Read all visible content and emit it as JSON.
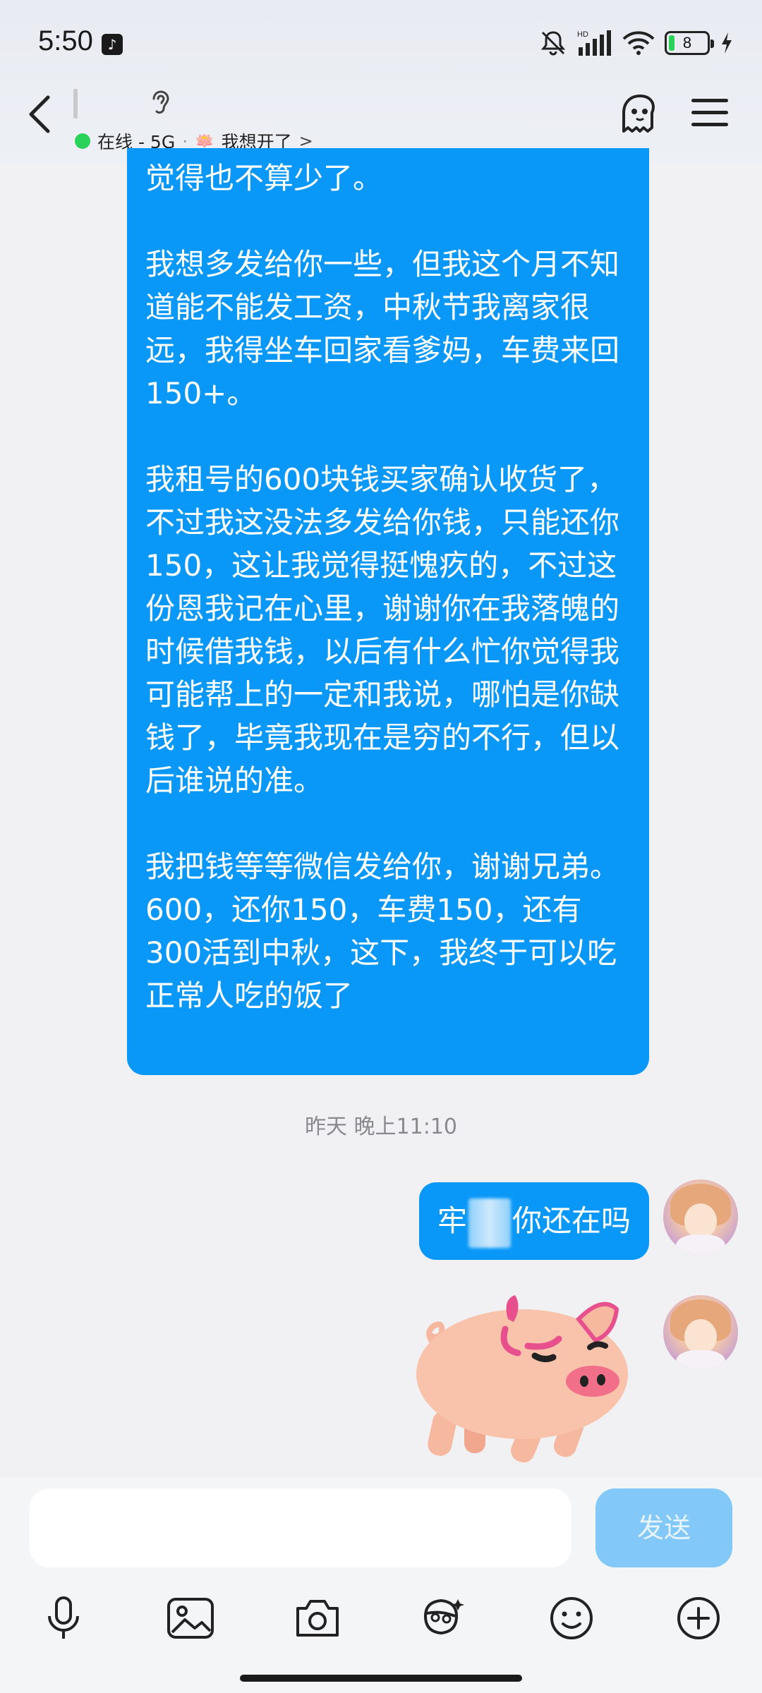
{
  "status_bar": {
    "time": "5:50",
    "network_label": "HD",
    "battery_level": "8",
    "battery_fraction": 0.08
  },
  "header": {
    "presence_text": "在线 - 5G",
    "mood_text": "我想开了",
    "mood_chevron": ">",
    "online_color": "#2bd25a",
    "icons": [
      "back-arrow-icon",
      "ear-icon",
      "ghost-icon",
      "menu-icon"
    ]
  },
  "messages": {
    "long_message": {
      "paragraphs": [
        "觉得也不算少了。",
        "我想多发给你一些，但我这个月不知道能不能发工资，中秋节我离家很远，我得坐车回家看爹妈，车费来回150+。",
        "我租号的600块钱买家确认收货了，不过我这没法多发给你钱，只能还你150，这让我觉得挺愧疚的，不过这份恩我记在心里，谢谢你在我落魄的时候借我钱，以后有什么忙你觉得我可能帮上的一定和我说，哪怕是你缺钱了，毕竟我现在是穷的不行，但以后谁说的准。",
        "我把钱等等微信发给你，谢谢兄弟。",
        "600，还你150，车费150，还有300活到中秋，这下，我终于可以吃正常人吃的饭了"
      ]
    },
    "timestamp": "昨天 晚上11:10",
    "outgoing_text_prefix": "牢",
    "outgoing_text_suffix": "你还在吗",
    "bubble_color": "#0a98f8"
  },
  "input_bar": {
    "placeholder": "",
    "send_label": "发送",
    "tools": [
      "microphone-icon",
      "image-icon",
      "camera-icon",
      "sticker-icon",
      "emoji-icon",
      "plus-icon"
    ]
  }
}
